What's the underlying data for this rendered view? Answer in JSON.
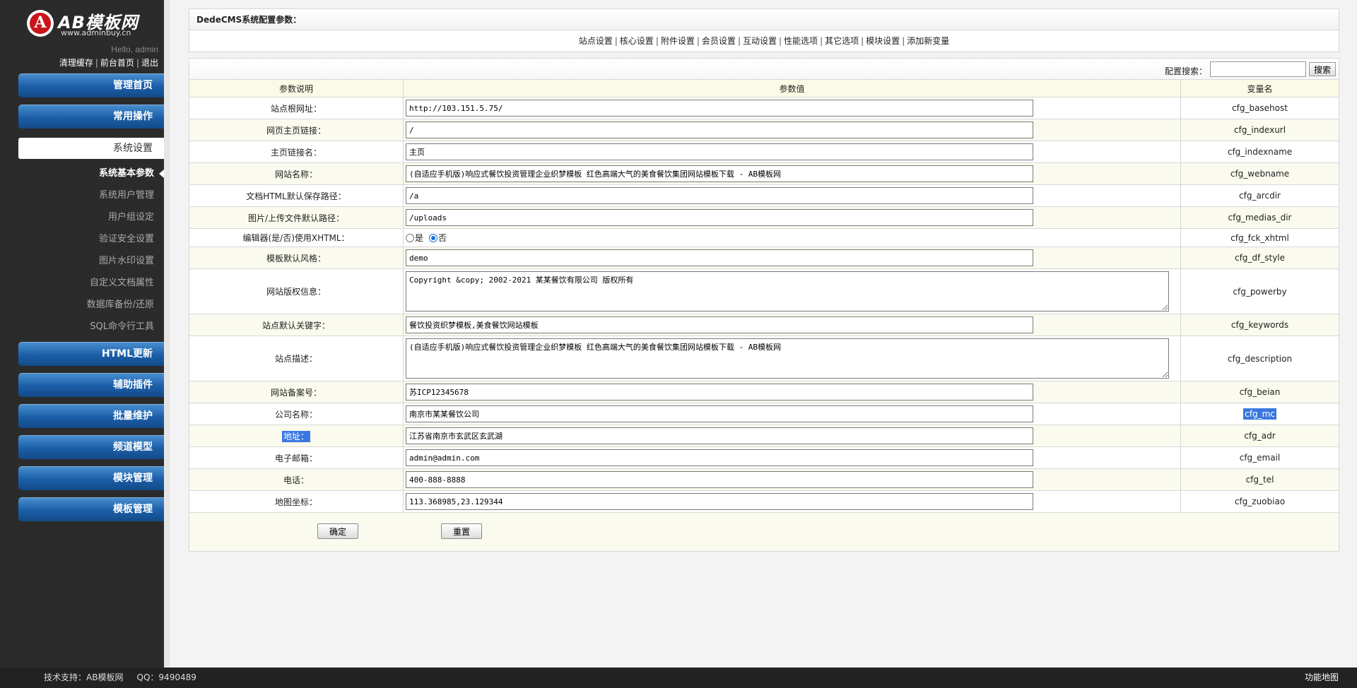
{
  "sidebar": {
    "logo_mark": "A",
    "logo_brand": "AB模板网",
    "logo_url": "www.adminbuy.cn",
    "hello": "Hello, admin",
    "links": [
      "清理缓存",
      "前台首页",
      "退出"
    ],
    "menu_top": [
      "管理首页",
      "常用操作"
    ],
    "active_menu": "系统设置",
    "submenu": [
      "系统基本参数",
      "系统用户管理",
      "用户组设定",
      "验证安全设置",
      "图片水印设置",
      "自定义文档属性",
      "数据库备份/还原",
      "SQL命令行工具"
    ],
    "menu_bottom": [
      "HTML更新",
      "辅助插件",
      "批量维护",
      "频道模型",
      "模块管理",
      "模板管理"
    ]
  },
  "main": {
    "title": "DedeCMS系统配置参数：",
    "tabs": [
      "站点设置",
      "核心设置",
      "附件设置",
      "会员设置",
      "互动设置",
      "性能选项",
      "其它选项",
      "模块设置",
      "添加新变量"
    ],
    "search_label": "配置搜索：",
    "search_button": "搜索",
    "headers": [
      "参数说明",
      "参数值",
      "变量名"
    ],
    "rows": [
      {
        "label": "站点根网址：",
        "value": "http://103.151.5.75/",
        "var": "cfg_basehost"
      },
      {
        "label": "网页主页链接：",
        "value": "/",
        "var": "cfg_indexurl"
      },
      {
        "label": "主页链接名：",
        "value": "主页",
        "var": "cfg_indexname"
      },
      {
        "label": "网站名称：",
        "value": "(自适应手机版)响应式餐饮投资管理企业织梦模板 红色高端大气的美食餐饮集团网站模板下载 - AB模板网",
        "var": "cfg_webname"
      },
      {
        "label": "文档HTML默认保存路径：",
        "value": "/a",
        "var": "cfg_arcdir"
      },
      {
        "label": "图片/上传文件默认路径：",
        "value": "/uploads",
        "var": "cfg_medias_dir"
      },
      {
        "label": "编辑器(是/否)使用XHTML：",
        "radio": [
          "是",
          "否"
        ],
        "selected": "否",
        "var": "cfg_fck_xhtml"
      },
      {
        "label": "模板默认风格：",
        "value": "demo",
        "var": "cfg_df_style"
      },
      {
        "label": "网站版权信息：",
        "textarea": "Copyright &copy; 2002-2021 某某餐饮有限公司 版权所有",
        "var": "cfg_powerby"
      },
      {
        "label": "站点默认关键字：",
        "value": "餐饮投资织梦模板,美食餐饮网站模板",
        "var": "cfg_keywords"
      },
      {
        "label": "站点描述：",
        "textarea": "(自适应手机版)响应式餐饮投资管理企业织梦模板 红色高端大气的美食餐饮集团网站模板下载 - AB模板网",
        "var": "cfg_description"
      },
      {
        "label": "网站备案号：",
        "value": "苏ICP12345678",
        "var": "cfg_beian"
      },
      {
        "label": "公司名称：",
        "value": "南京市某某餐饮公司",
        "var": "cfg_mc"
      },
      {
        "label": "地址：",
        "value": "江苏省南京市玄武区玄武湖",
        "var": "cfg_adr"
      },
      {
        "label": "电子邮箱：",
        "value": "admin@admin.com",
        "var": "cfg_email"
      },
      {
        "label": "电话：",
        "value": "400-888-8888",
        "var": "cfg_tel"
      },
      {
        "label": "地图坐标：",
        "value": "113.368985,23.129344",
        "var": "cfg_zuobiao"
      }
    ],
    "confirm": "确定",
    "reset": "重置"
  },
  "footer": {
    "support": "技术支持：AB模板网",
    "qq": "QQ：9490489",
    "sitemap": "功能地图"
  }
}
